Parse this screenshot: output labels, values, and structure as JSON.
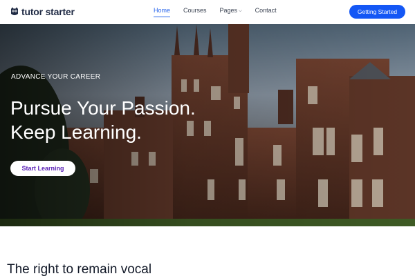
{
  "brand": {
    "name": "tutor starter",
    "icon": "owl-logo-icon",
    "color": "#1f2a44"
  },
  "nav": {
    "items": [
      {
        "label": "Home",
        "active": true
      },
      {
        "label": "Courses",
        "active": false
      },
      {
        "label": "Pages",
        "active": false,
        "has_dropdown": true
      },
      {
        "label": "Contact",
        "active": false
      }
    ],
    "accent": "#2563eb"
  },
  "header_cta": {
    "label": "Getting Started",
    "color": "#1457f5"
  },
  "hero": {
    "eyebrow": "ADVANCE YOUR CAREER",
    "headline_line1": "Pursue Your Passion.",
    "headline_line2": "Keep Learning.",
    "button_label": "Start Learning",
    "button_text_color": "#5b21b6",
    "background_image": "gothic-university-building-photo"
  },
  "section": {
    "title": "The right to remain vocal"
  }
}
